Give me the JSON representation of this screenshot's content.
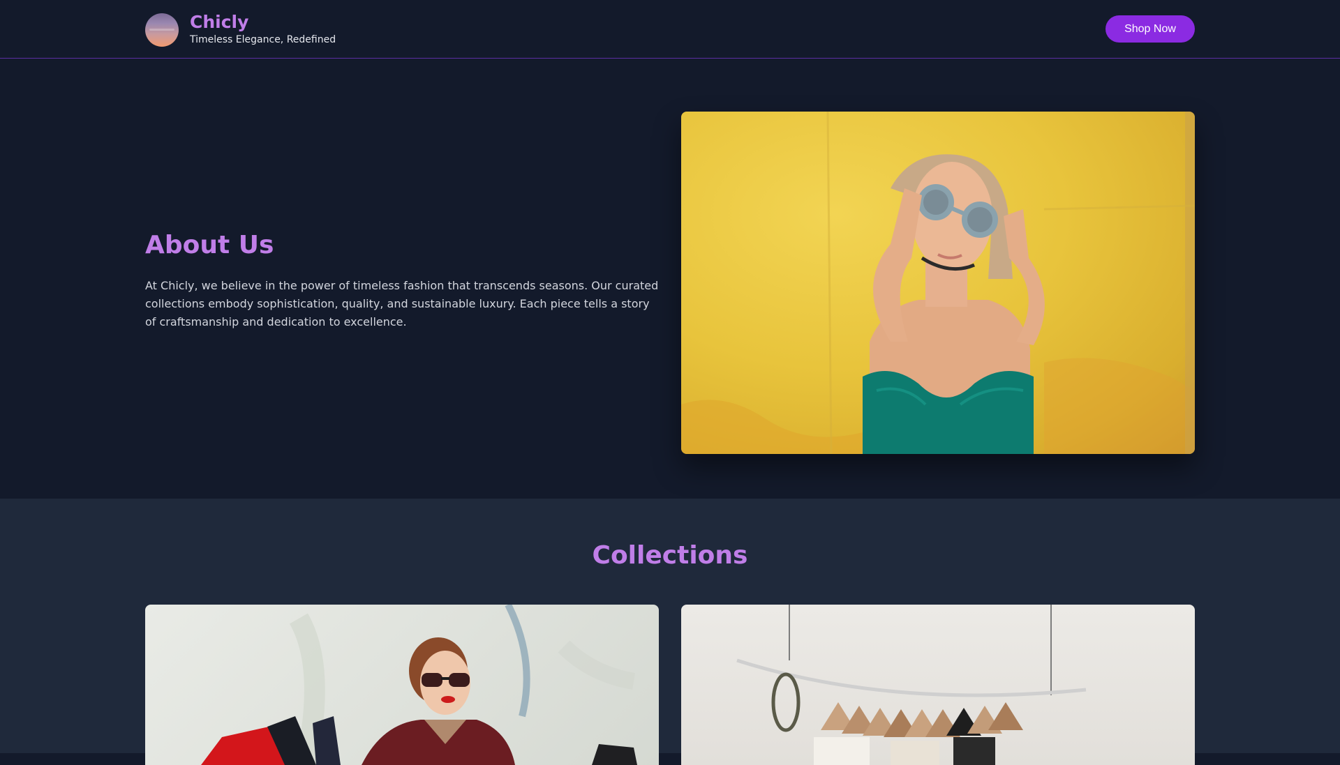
{
  "header": {
    "brand_name": "Chicly",
    "tagline": "Timeless Elegance, Redefined",
    "shop_button": "Shop Now",
    "logo_icon": "brand-logo-icon"
  },
  "about": {
    "title": "About Us",
    "text": "At Chicly, we believe in the power of timeless fashion that transcends seasons. Our curated collections embody sophistication, quality, and sustainable luxury. Each piece tells a story of craftsmanship and dedication to excellence."
  },
  "collections": {
    "title": "Collections"
  },
  "colors": {
    "accent": "#c07ee8",
    "button": "#8b2be2",
    "background": "#131a2b",
    "section_background": "#1f293b"
  }
}
